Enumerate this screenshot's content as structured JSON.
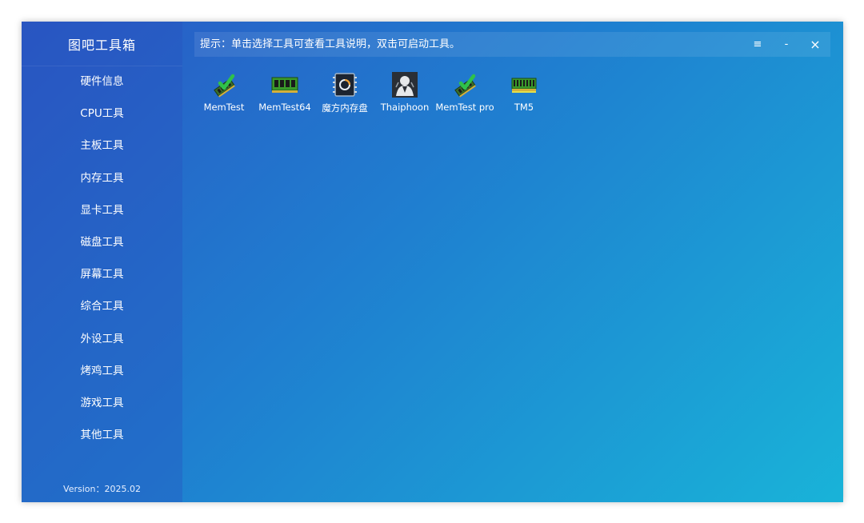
{
  "app": {
    "title": "图吧工具箱",
    "version": "Version：2025.02"
  },
  "sidebar": {
    "items": [
      {
        "label": "硬件信息"
      },
      {
        "label": "CPU工具"
      },
      {
        "label": "主板工具"
      },
      {
        "label": "内存工具"
      },
      {
        "label": "显卡工具"
      },
      {
        "label": "磁盘工具"
      },
      {
        "label": "屏幕工具"
      },
      {
        "label": "综合工具"
      },
      {
        "label": "外设工具"
      },
      {
        "label": "烤鸡工具"
      },
      {
        "label": "游戏工具"
      },
      {
        "label": "其他工具"
      }
    ]
  },
  "topbar": {
    "tip": "提示：单击选择工具可查看工具说明，双击可启动工具。",
    "menu_label": "≡",
    "minimize_label": "-",
    "close_label": "×"
  },
  "tools": [
    {
      "label": "MemTest",
      "icon": "memtest-icon"
    },
    {
      "label": "MemTest64",
      "icon": "memtest64-icon"
    },
    {
      "label": "魔方内存盘",
      "icon": "chip-disk-icon"
    },
    {
      "label": "Thaiphoon",
      "icon": "thaiphoon-icon"
    },
    {
      "label": "MemTest pro",
      "icon": "memtest-pro-icon"
    },
    {
      "label": "TM5",
      "icon": "tm5-icon"
    }
  ],
  "colors": {
    "gradient_start": "#2a58c4",
    "gradient_mid": "#1f7fd0",
    "gradient_end": "#19b3d8",
    "text": "#ffffff",
    "check_green": "#2fc24a",
    "ram_green": "#3a9a2a"
  }
}
